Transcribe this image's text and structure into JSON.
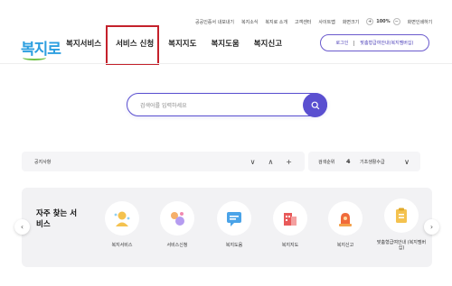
{
  "utility_links": [
    "공공인증서 내보내기",
    "복지소식",
    "복지로 소개",
    "고객센터",
    "사이트맵",
    "화면크기"
  ],
  "zoom": {
    "plus": "+",
    "value": "100%",
    "minus": "−"
  },
  "utility_last": "화면인쇄하기",
  "logo": "복지로",
  "gnb": [
    "복지서비스",
    "서비스 신청",
    "복지지도",
    "복지도움",
    "복지신고"
  ],
  "user": {
    "login": "로그인",
    "mypage": "맞춤형급여안내(복지멤버십)"
  },
  "search": {
    "placeholder": "검색어를 입력하세요"
  },
  "notice": {
    "label": "공지사항",
    "down": "∨",
    "up": "∧",
    "more": "+"
  },
  "rank": {
    "label": "검색순위",
    "number": "4",
    "keyword": "기초생활수급",
    "chevron": "∨"
  },
  "quick": {
    "title": "자주 찾는 서비스",
    "prev": "‹",
    "next": "›",
    "items": [
      {
        "label": "복지서비스",
        "icon": "welfare-service-icon"
      },
      {
        "label": "서비스신청",
        "icon": "service-apply-icon"
      },
      {
        "label": "복지도움",
        "icon": "welfare-help-icon"
      },
      {
        "label": "복지지도",
        "icon": "welfare-map-icon"
      },
      {
        "label": "복지신고",
        "icon": "welfare-report-icon"
      },
      {
        "label": "맞춤형급여안내 (복지멤버십)",
        "icon": "membership-icon"
      }
    ]
  },
  "colors": {
    "primary": "#5a4fd0",
    "logo_blue": "#2d9fe0",
    "logo_green": "#6fc144",
    "highlight": "#c4212b"
  }
}
